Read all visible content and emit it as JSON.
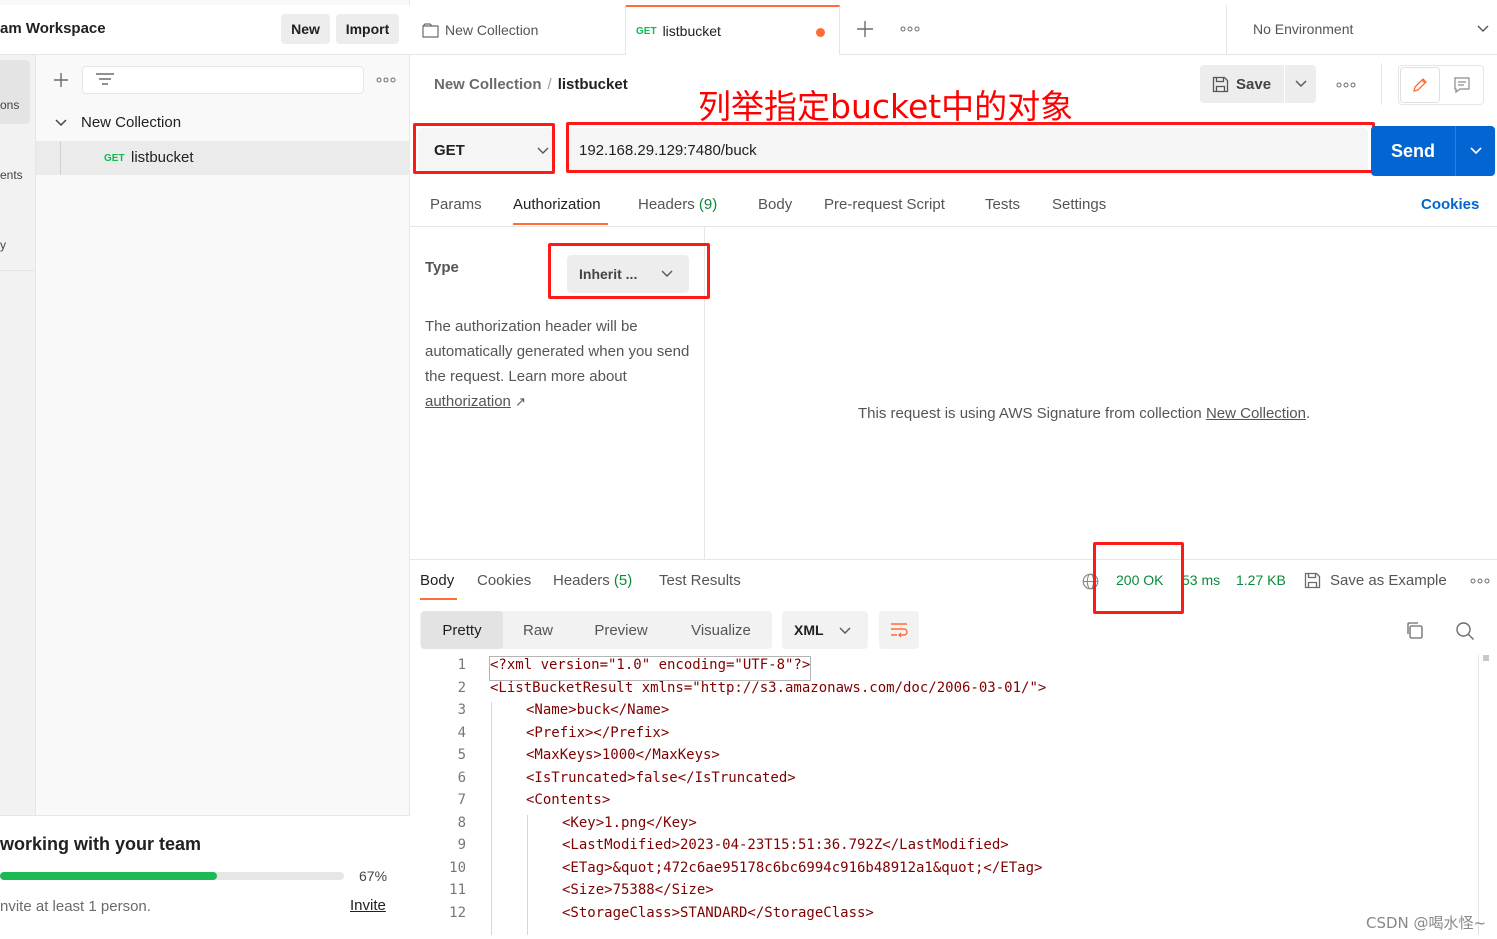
{
  "sidebar": {
    "workspace_title": "am Workspace",
    "new_label": "New",
    "import_label": "Import",
    "rail_labels": [
      "ons",
      "ents",
      "y"
    ],
    "collection_name": "New Collection",
    "request_method": "GET",
    "request_name": "listbucket",
    "onboarding": {
      "title": "working with your team",
      "progress_text": "67%",
      "progress": 0.67,
      "subtitle": "nvite at least 1 person.",
      "invite_label": "Invite"
    }
  },
  "tabs": [
    {
      "label": "New Collection"
    },
    {
      "method": "GET",
      "label": "listbucket"
    }
  ],
  "environment": {
    "label": "No Environment"
  },
  "breadcrumb": {
    "parent": "New Collection",
    "separator": "/",
    "current": "listbucket"
  },
  "annotation": "列举指定bucket中的对象",
  "toolbar": {
    "save_label": "Save"
  },
  "request": {
    "method": "GET",
    "url": "192.168.29.129:7480/buck",
    "send_label": "Send"
  },
  "request_tabs": [
    "Params",
    "Authorization",
    "Headers",
    "(9)",
    "Body",
    "Pre-request Script",
    "Tests",
    "Settings"
  ],
  "cookies_label": "Cookies",
  "auth": {
    "type_label": "Type",
    "type_value": "Inherit ...",
    "description": "The authorization header will be automatically generated when you send the request. Learn more about",
    "link_text": "authorization",
    "message_prefix": "This request is using AWS Signature from collection",
    "message_link": "New Collection",
    "message_suffix": "."
  },
  "response": {
    "tabs": [
      "Body",
      "Cookies",
      "Headers",
      "(5)",
      "Test Results"
    ],
    "status": "200 OK",
    "time": "53 ms",
    "size": "1.27 KB",
    "save_example_label": "Save as Example",
    "views": [
      "Pretty",
      "Raw",
      "Preview",
      "Visualize"
    ],
    "format": "XML"
  },
  "code_lines": [
    "<?xml version=\"1.0\" encoding=\"UTF-8\"?>",
    "<ListBucketResult xmlns=\"http://s3.amazonaws.com/doc/2006-03-01/\">",
    "<Name>buck</Name>",
    "<Prefix></Prefix>",
    "<MaxKeys>1000</MaxKeys>",
    "<IsTruncated>false</IsTruncated>",
    "<Contents>",
    "<Key>1.png</Key>",
    "<LastModified>2023-04-23T15:51:36.792Z</LastModified>",
    "<ETag>&quot;472c6ae95178c6bc6994c916b48912a1&quot;</ETag>",
    "<Size>75388</Size>",
    "<StorageClass>STANDARD</StorageClass>"
  ],
  "code_numbers": [
    "1",
    "2",
    "3",
    "4",
    "5",
    "6",
    "7",
    "8",
    "9",
    "10",
    "11",
    "12"
  ],
  "watermark": "CSDN @喝水怪~",
  "colors": {
    "accent": "#ff6c37",
    "send": "#0265d2",
    "status": "#0a8a3c",
    "annotation": "#ff0000"
  }
}
